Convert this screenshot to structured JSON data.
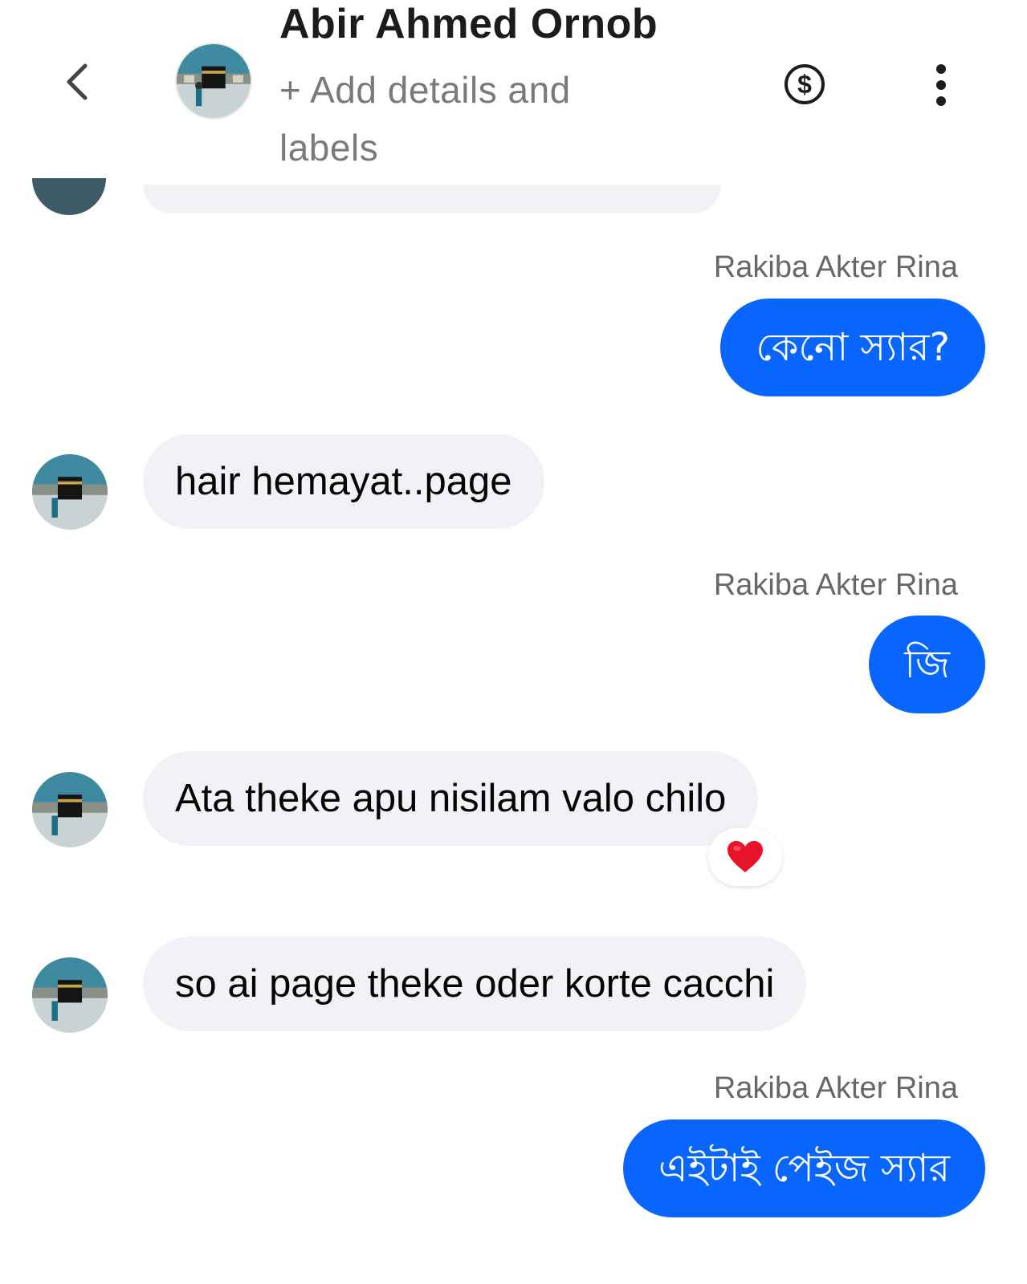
{
  "header": {
    "title": "Abir Ahmed Ornob",
    "subtitle": "+ Add details and labels",
    "back_icon": "chevron-left-icon",
    "dollar_icon": "dollar-circle-icon",
    "more_icon": "more-vertical-icon"
  },
  "messages": [
    {
      "sender": "Rakiba Akter Rina",
      "text": "কেনো স্যার?",
      "direction": "outgoing"
    },
    {
      "text": "hair hemayat..page",
      "direction": "incoming"
    },
    {
      "sender": "Rakiba Akter Rina",
      "text": "জি",
      "direction": "outgoing"
    },
    {
      "text": "Ata theke apu nisilam valo chilo",
      "direction": "incoming",
      "reaction": "heart"
    },
    {
      "text": "so ai page theke oder korte cacchi",
      "direction": "incoming"
    },
    {
      "sender": "Rakiba Akter Rina",
      "text": "এইটাই পেইজ স্যার",
      "direction": "outgoing"
    }
  ],
  "colors": {
    "outgoing_bubble": "#0866ff",
    "incoming_bubble": "#f0f2f5",
    "reaction_heart": "#e8132b"
  }
}
